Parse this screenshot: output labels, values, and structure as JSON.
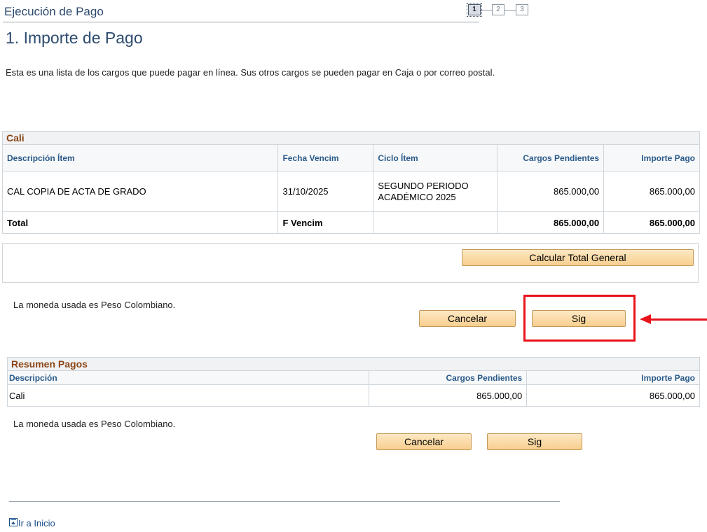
{
  "header": {
    "title": "Ejecución de Pago",
    "steps": [
      "1",
      "2",
      "3"
    ],
    "active_step": 1
  },
  "page_title": "1. Importe de Pago",
  "intro_text": "Esta es una lista de los cargos que puede pagar en línea. Sus otros cargos se pueden pagar en Caja o por correo postal.",
  "main_grid": {
    "caption": "Cali",
    "columns": [
      "Descripción Ítem",
      "Fecha Vencim",
      "Ciclo Ítem",
      "Cargos Pendientes",
      "Importe Pago"
    ],
    "rows": [
      {
        "descripcion": "CAL COPIA DE ACTA DE GRADO",
        "fecha": "31/10/2025",
        "ciclo": "SEGUNDO PERIODO ACADÉMICO 2025",
        "cargos": "865.000,00",
        "importe": "865.000,00"
      }
    ],
    "total": {
      "label": "Total",
      "fecha": "F Vencim",
      "ciclo": "",
      "cargos": "865.000,00",
      "importe": "865.000,00"
    }
  },
  "calc_button": "Calcular Total General",
  "currency_note": "La moneda usada es Peso Colombiano.",
  "buttons": {
    "cancel": "Cancelar",
    "next": "Sig"
  },
  "summary_grid": {
    "caption": "Resumen Pagos",
    "columns": [
      "Descripción",
      "Cargos Pendientes",
      "Importe Pago"
    ],
    "rows": [
      {
        "descripcion": "Cali",
        "cargos": "865.000,00",
        "importe": "865.000,00"
      }
    ]
  },
  "top_link": "Ir a Inicio",
  "colors": {
    "highlight": "#e8131b",
    "caption": "#8b4513",
    "header_text": "#2a5a8a",
    "title": "#2c4a6e"
  },
  "icons": [
    "go-to-top-icon",
    "left-arrow-icon"
  ]
}
